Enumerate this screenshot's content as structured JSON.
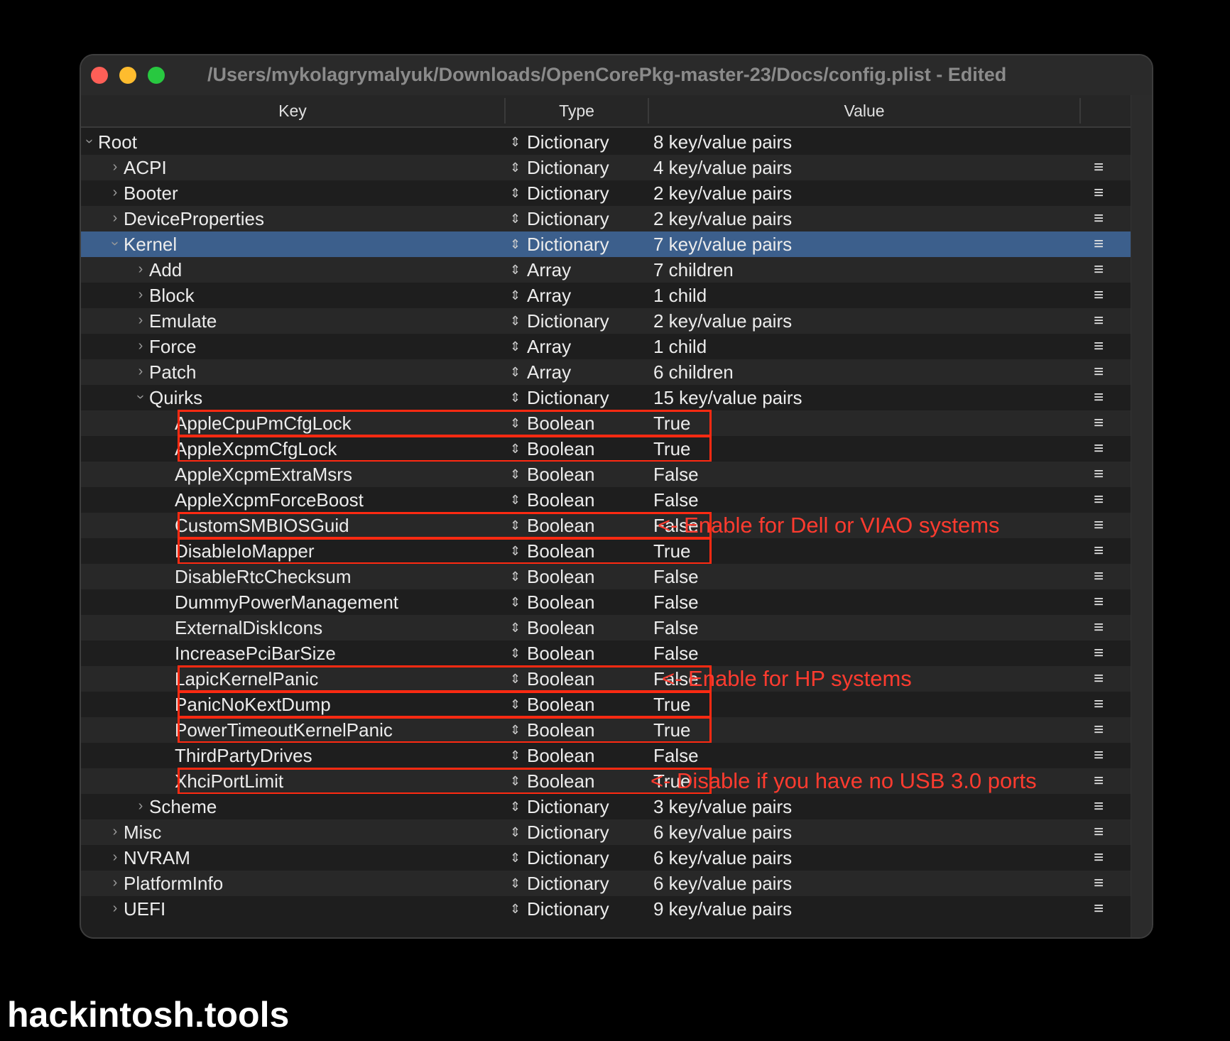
{
  "window": {
    "title": "/Users/mykolagrymalyuk/Downloads/OpenCorePkg-master-23/Docs/config.plist - Edited"
  },
  "columns": {
    "key": "Key",
    "type": "Type",
    "value": "Value"
  },
  "colors": {
    "selected_row": "#3c5f8c",
    "highlight_border": "#ff2a12",
    "annotation": "#ff3b2f"
  },
  "rows": [
    {
      "key": "Root",
      "type": "Dictionary",
      "value": "8 key/value pairs",
      "disclosure": "open",
      "menu": false
    },
    {
      "key": "ACPI",
      "type": "Dictionary",
      "value": "4 key/value pairs",
      "disclosure": "closed",
      "menu": true
    },
    {
      "key": "Booter",
      "type": "Dictionary",
      "value": "2 key/value pairs",
      "disclosure": "closed",
      "menu": true
    },
    {
      "key": "DeviceProperties",
      "type": "Dictionary",
      "value": "2 key/value pairs",
      "disclosure": "closed",
      "menu": true
    },
    {
      "key": "Kernel",
      "type": "Dictionary",
      "value": "7 key/value pairs",
      "disclosure": "open",
      "menu": true,
      "selected": true
    },
    {
      "key": "Add",
      "type": "Array",
      "value": "7 children",
      "disclosure": "closed",
      "menu": true
    },
    {
      "key": "Block",
      "type": "Array",
      "value": "1 child",
      "disclosure": "closed",
      "menu": true
    },
    {
      "key": "Emulate",
      "type": "Dictionary",
      "value": "2 key/value pairs",
      "disclosure": "closed",
      "menu": true
    },
    {
      "key": "Force",
      "type": "Array",
      "value": "1 child",
      "disclosure": "closed",
      "menu": true
    },
    {
      "key": "Patch",
      "type": "Array",
      "value": "6 children",
      "disclosure": "closed",
      "menu": true
    },
    {
      "key": "Quirks",
      "type": "Dictionary",
      "value": "15 key/value pairs",
      "disclosure": "open",
      "menu": true
    },
    {
      "key": "AppleCpuPmCfgLock",
      "type": "Boolean",
      "value": "True",
      "menu": true,
      "highlight": true
    },
    {
      "key": "AppleXcpmCfgLock",
      "type": "Boolean",
      "value": "True",
      "menu": true,
      "highlight": true
    },
    {
      "key": "AppleXcpmExtraMsrs",
      "type": "Boolean",
      "value": "False",
      "menu": true
    },
    {
      "key": "AppleXcpmForceBoost",
      "type": "Boolean",
      "value": "False",
      "menu": true
    },
    {
      "key": "CustomSMBIOSGuid",
      "type": "Boolean",
      "value": "False",
      "menu": true,
      "highlight": true,
      "note": "<- Enable for Dell or VIAO systems"
    },
    {
      "key": "DisableIoMapper",
      "type": "Boolean",
      "value": "True",
      "menu": true,
      "highlight": true
    },
    {
      "key": "DisableRtcChecksum",
      "type": "Boolean",
      "value": "False",
      "menu": true
    },
    {
      "key": "DummyPowerManagement",
      "type": "Boolean",
      "value": "False",
      "menu": true
    },
    {
      "key": "ExternalDiskIcons",
      "type": "Boolean",
      "value": "False",
      "menu": true
    },
    {
      "key": "IncreasePciBarSize",
      "type": "Boolean",
      "value": "False",
      "menu": true
    },
    {
      "key": "LapicKernelPanic",
      "type": "Boolean",
      "value": "False",
      "menu": true,
      "highlight": true,
      "note": "<- Enable for HP systems"
    },
    {
      "key": "PanicNoKextDump",
      "type": "Boolean",
      "value": "True",
      "menu": true,
      "highlight": true
    },
    {
      "key": "PowerTimeoutKernelPanic",
      "type": "Boolean",
      "value": "True",
      "menu": true,
      "highlight": true
    },
    {
      "key": "ThirdPartyDrives",
      "type": "Boolean",
      "value": "False",
      "menu": true
    },
    {
      "key": "XhciPortLimit",
      "type": "Boolean",
      "value": "True",
      "menu": true,
      "highlight": true,
      "note": "<- Disable if you have no USB 3.0 ports"
    },
    {
      "key": "Scheme",
      "type": "Dictionary",
      "value": "3 key/value pairs",
      "disclosure": "closed",
      "menu": true
    },
    {
      "key": "Misc",
      "type": "Dictionary",
      "value": "6 key/value pairs",
      "disclosure": "closed",
      "menu": true
    },
    {
      "key": "NVRAM",
      "type": "Dictionary",
      "value": "6 key/value pairs",
      "disclosure": "closed",
      "menu": true
    },
    {
      "key": "PlatformInfo",
      "type": "Dictionary",
      "value": "6 key/value pairs",
      "disclosure": "closed",
      "menu": true
    },
    {
      "key": "UEFI",
      "type": "Dictionary",
      "value": "9 key/value pairs",
      "disclosure": "closed",
      "menu": true
    }
  ],
  "watermark": "hackintosh.tools"
}
